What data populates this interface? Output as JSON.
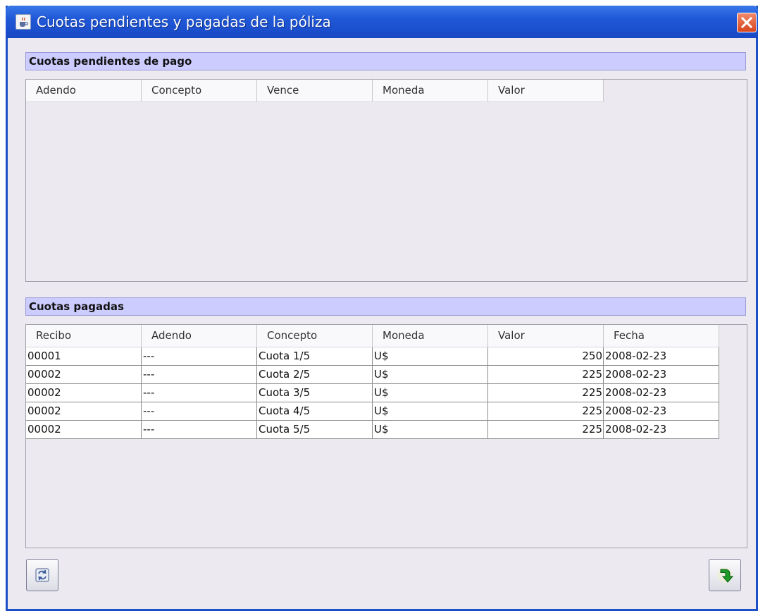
{
  "window": {
    "title": "Cuotas pendientes y pagadas de la póliza",
    "title_icon": "java-cup-icon",
    "close_icon": "close-icon"
  },
  "pending": {
    "header": "Cuotas pendientes de pago",
    "columns": [
      "Adendo",
      "Concepto",
      "Vence",
      "Moneda",
      "Valor"
    ],
    "rows": []
  },
  "paid": {
    "header": "Cuotas pagadas",
    "columns": [
      "Recibo",
      "Adendo",
      "Concepto",
      "Moneda",
      "Valor",
      "Fecha"
    ],
    "rows": [
      [
        "00001",
        "---",
        "Cuota 1/5",
        "U$",
        "250",
        "2008-02-23"
      ],
      [
        "00002",
        "---",
        "Cuota 2/5",
        "U$",
        "225",
        "2008-02-23"
      ],
      [
        "00002",
        "---",
        "Cuota 3/5",
        "U$",
        "225",
        "2008-02-23"
      ],
      [
        "00002",
        "---",
        "Cuota 4/5",
        "U$",
        "225",
        "2008-02-23"
      ],
      [
        "00002",
        "---",
        "Cuota 5/5",
        "U$",
        "225",
        "2008-02-23"
      ]
    ]
  },
  "buttons": {
    "refresh_icon": "refresh-icon",
    "exit_icon": "green-return-arrow-icon"
  },
  "colors": {
    "titlebar": "#2058d8",
    "section_header": "#ccccff",
    "window_bg": "#eceaf0"
  }
}
